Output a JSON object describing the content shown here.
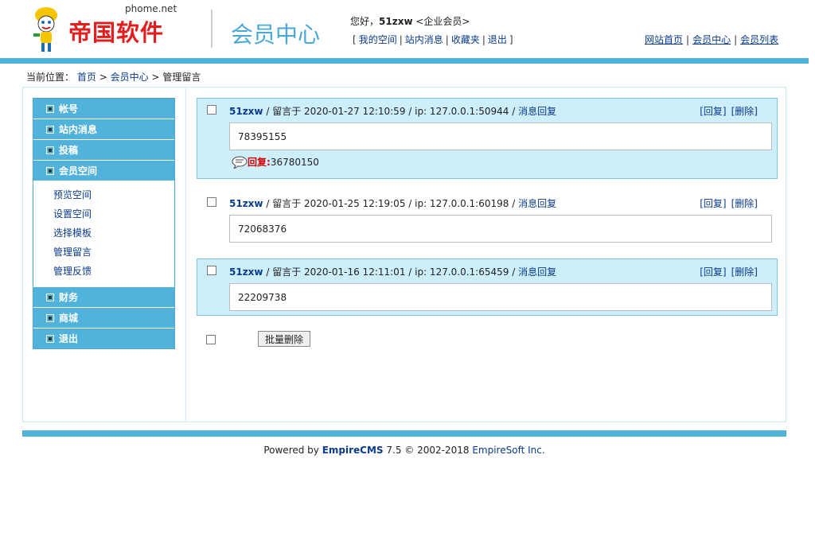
{
  "header": {
    "logo_url": "phome.net",
    "logo_brand": "帝国软件",
    "member_title": "会员中心",
    "greeting_prefix": "您好，",
    "username": "51zxw",
    "group": "<企业会员>",
    "quicklinks": [
      "我的空间",
      "站内消息",
      "收藏夹",
      "退出"
    ],
    "right_links": [
      "网站首页",
      "会员中心",
      "会员列表"
    ]
  },
  "breadcrumb": {
    "prefix": "当前位置：",
    "home": "首页",
    "sep": ">",
    "member_center": "会员中心",
    "current": "管理留言"
  },
  "sidebar": {
    "items": [
      {
        "label": "帐号"
      },
      {
        "label": "站内消息"
      },
      {
        "label": "投稿"
      },
      {
        "label": "会员空间"
      }
    ],
    "sub_items": [
      "预览空间",
      "设置空间",
      "选择模板",
      "管理留言",
      "管理反馈"
    ],
    "items_after": [
      {
        "label": "财务"
      },
      {
        "label": "商城"
      },
      {
        "label": "退出"
      }
    ]
  },
  "messages": [
    {
      "user": "51zxw",
      "meta": " / 留言于 2020-01-27 12:10:59 / ip: 127.0.0.1:50944 / ",
      "reply_link": "消息回复",
      "reply_btn": "[回复]",
      "delete_btn": "[删除]",
      "content": "78395155",
      "reply_label": "回复:",
      "reply_text": " 36780150"
    },
    {
      "user": "51zxw",
      "meta": " / 留言于 2020-01-25 12:19:05 / ip: 127.0.0.1:60198 / ",
      "reply_link": "消息回复",
      "reply_btn": "[回复]",
      "delete_btn": "[删除]",
      "content": "72068376"
    },
    {
      "user": "51zxw",
      "meta": " / 留言于 2020-01-16 12:11:01 / ip: 127.0.0.1:65459 / ",
      "reply_link": "消息回复",
      "reply_btn": "[回复]",
      "delete_btn": "[删除]",
      "content": "22209738"
    }
  ],
  "bulk_delete_label": "批量删除",
  "footer": {
    "powered": "Powered by ",
    "cms": "EmpireCMS",
    "version": " 7.5  © 2002-2018 ",
    "company": "EmpireSoft Inc."
  },
  "colors": {
    "accent": "#4fb4d8",
    "menu_bg": "#51b2dc",
    "highlight_bg": "#cdeefb",
    "brand_red": "#e21f1f"
  }
}
